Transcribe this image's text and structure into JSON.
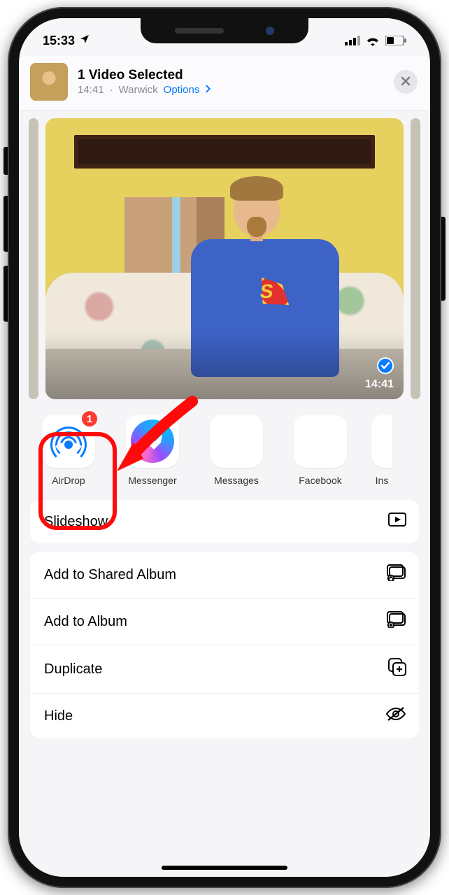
{
  "status": {
    "time": "15:33"
  },
  "header": {
    "title": "1 Video Selected",
    "time": "14:41",
    "location": "Warwick",
    "options": "Options"
  },
  "preview": {
    "duration": "14:41",
    "selected": true
  },
  "airdrop_badge": "1",
  "apps": {
    "items": [
      {
        "label": "AirDrop"
      },
      {
        "label": "Messenger"
      },
      {
        "label": "Messages"
      },
      {
        "label": "Facebook"
      },
      {
        "label": "Instagram"
      }
    ],
    "partial_label": "Ins"
  },
  "actions": {
    "slideshow": "Slideshow",
    "add_shared": "Add to Shared Album",
    "add_album": "Add to Album",
    "duplicate": "Duplicate",
    "hide": "Hide"
  }
}
